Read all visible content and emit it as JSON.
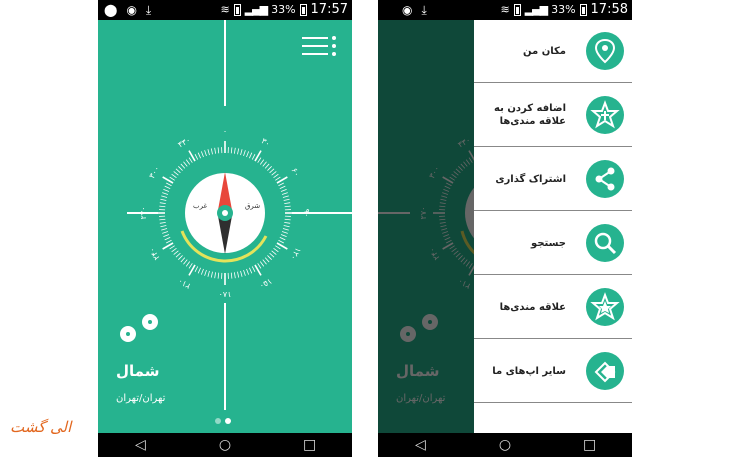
{
  "colors": {
    "accent": "#26b38f",
    "arc": "#e4e35a",
    "needle_red": "#e8473b",
    "needle_dark": "#2f2f2f"
  },
  "status_left": {
    "icons": [
      "location-icon",
      "app-icon",
      "download-icon"
    ],
    "battery": "33%",
    "time": "17:57"
  },
  "status_right": {
    "icons": [
      "app-icon",
      "download-icon"
    ],
    "battery": "33%",
    "time": "17:58"
  },
  "compass": {
    "east_label": "شرق",
    "west_label": "غرب",
    "degree_labels": [
      "۰",
      "۳۰",
      "۶۰",
      "۹۰",
      "۱۲۰",
      "۱۵۰",
      "۱۸۰",
      "۲۱۰",
      "۲۴۰",
      "۲۷۰",
      "۳۰۰",
      "۳۳۰"
    ]
  },
  "main": {
    "title": "شمال",
    "city": "تهران/تهران",
    "pages": 2,
    "active_page": 2
  },
  "drawer": {
    "items": [
      {
        "label": "مکان من",
        "icon": "location-pin-icon"
      },
      {
        "label": "اضافه کردن به علاقه مندی‌ها",
        "icon": "add-favorite-icon"
      },
      {
        "label": "اشتراک گذاری",
        "icon": "share-icon"
      },
      {
        "label": "جستجو",
        "icon": "search-icon"
      },
      {
        "label": "علاقه مندی‌ها",
        "icon": "favorites-star-icon"
      },
      {
        "label": "سایر اپ‌های ما",
        "icon": "other-apps-icon"
      }
    ]
  },
  "navbar": {
    "back": "◁",
    "home": "○",
    "recent": "□"
  },
  "brand": {
    "logo_text": "الی گشت"
  }
}
